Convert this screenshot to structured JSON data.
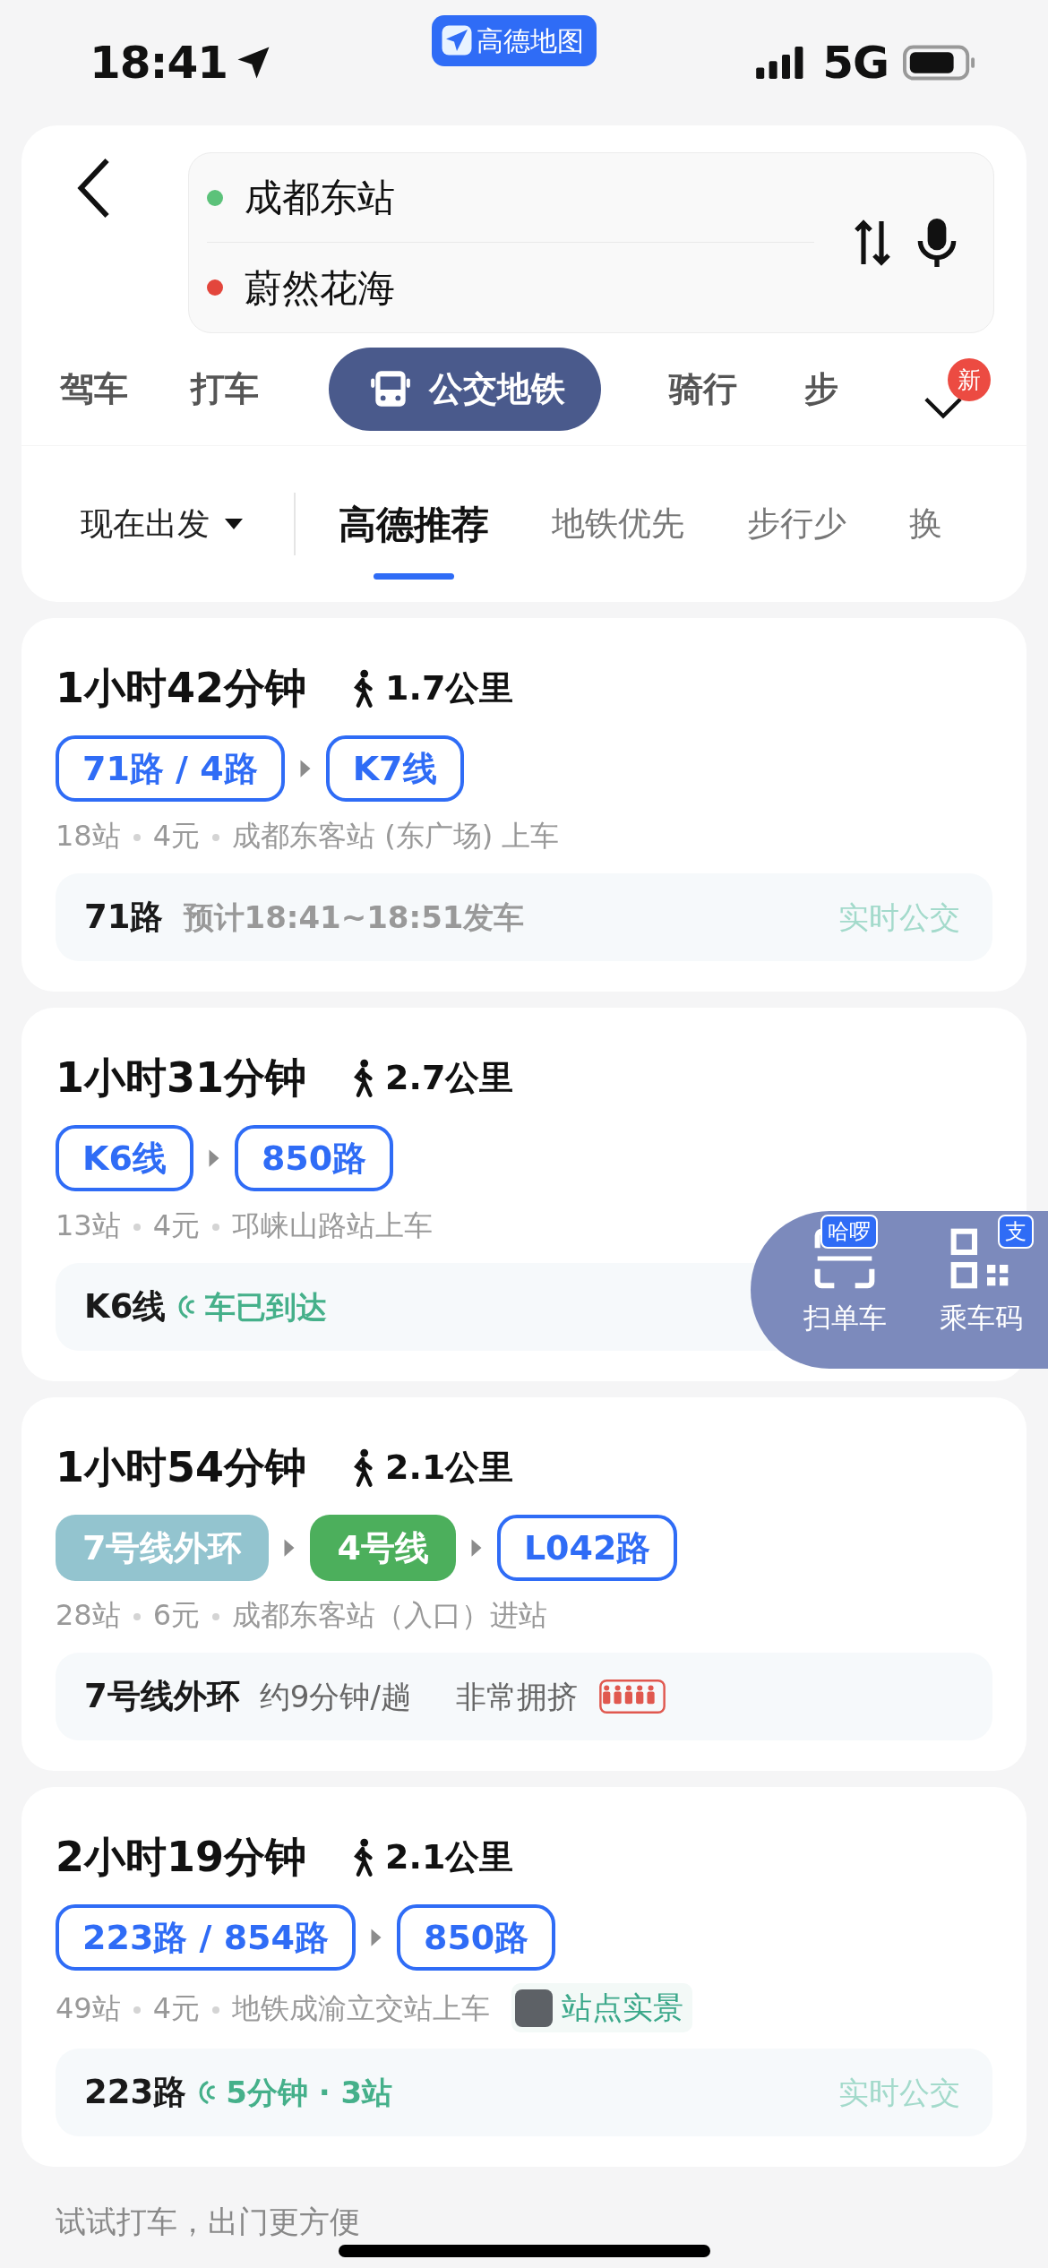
{
  "status_bar": {
    "time": "18:41",
    "app_pill": "高德地图",
    "network": "5G"
  },
  "route_input": {
    "origin": "成都东站",
    "destination": "蔚然花海"
  },
  "modes": [
    {
      "label": "驾车",
      "selected": false
    },
    {
      "label": "打车",
      "selected": false
    },
    {
      "label": "公交地铁",
      "selected": true
    },
    {
      "label": "骑行",
      "selected": false
    },
    {
      "label": "步",
      "selected": false
    }
  ],
  "modes_badge": "新",
  "departure": "现在出发",
  "sort_tabs": [
    {
      "label": "高德推荐",
      "selected": true
    },
    {
      "label": "地铁优先",
      "selected": false
    },
    {
      "label": "步行少",
      "selected": false
    },
    {
      "label": "换",
      "selected": false
    }
  ],
  "routes": [
    {
      "duration": "1小时42分钟",
      "walk": "1.7公里",
      "segments": [
        {
          "label": "71路 / 4路",
          "kind": "bus"
        },
        {
          "label": "K7线",
          "kind": "bus"
        }
      ],
      "info": [
        "18站",
        "4元",
        "成都东客站 (东广场) 上车"
      ],
      "realtime": {
        "kind": "schedule",
        "line": "71路",
        "texts": [
          "预计18:41~18:51发车"
        ]
      },
      "realtime_label": "实时公交"
    },
    {
      "duration": "1小时31分钟",
      "walk": "2.7公里",
      "segments": [
        {
          "label": "K6线",
          "kind": "bus"
        },
        {
          "label": "850路",
          "kind": "bus"
        }
      ],
      "info": [
        "13站",
        "4元",
        "邛崃山路站上车"
      ],
      "realtime": {
        "kind": "arrival",
        "line": "K6线",
        "texts": [
          "车已到达"
        ]
      }
    },
    {
      "duration": "1小时54分钟",
      "walk": "2.1公里",
      "segments": [
        {
          "label": "7号线外环",
          "kind": "metro",
          "color": "#93c4cf"
        },
        {
          "label": "4号线",
          "kind": "metro",
          "color": "#4caf5c"
        },
        {
          "label": "L042路",
          "kind": "bus"
        }
      ],
      "info": [
        "28站",
        "6元",
        "成都东客站（入口）进站"
      ],
      "realtime": {
        "kind": "crowding",
        "line": "7号线外环",
        "texts": [
          "约9分钟/趟",
          "非常拥挤"
        ]
      }
    },
    {
      "duration": "2小时19分钟",
      "walk": "2.1公里",
      "segments": [
        {
          "label": "223路 / 854路",
          "kind": "bus"
        },
        {
          "label": "850路",
          "kind": "bus"
        }
      ],
      "info": [
        "49站",
        "4元",
        "地铁成渝立交站上车"
      ],
      "scene_chip": "站点实景",
      "realtime": {
        "kind": "arrival",
        "line": "223路",
        "texts": [
          "5分钟 · 3站"
        ]
      },
      "realtime_label": "实时公交"
    }
  ],
  "quick_actions": [
    {
      "label": "扫单车",
      "badge": "哈啰",
      "kind": "scan"
    },
    {
      "label": "乘车码",
      "badge": "支",
      "kind": "qr"
    }
  ],
  "footer_hint": "试试打车，出门更方便"
}
